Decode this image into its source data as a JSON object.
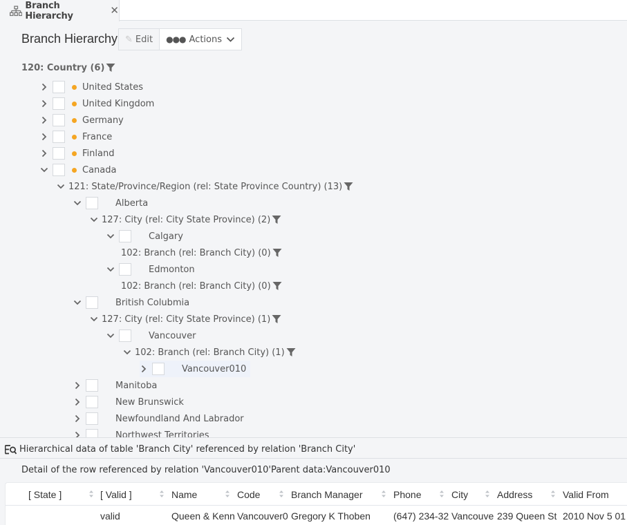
{
  "tab": {
    "icon": "hierarchy-icon",
    "label": "Branch Hierarchy",
    "close_icon": "close-icon"
  },
  "header": {
    "title": "Branch Hierarchy",
    "edit_label": "Edit",
    "actions_label": "Actions"
  },
  "tree": {
    "root_group": "120: Country (6)",
    "countries": [
      {
        "label": "United States",
        "expanded": false
      },
      {
        "label": "United Kingdom",
        "expanded": false
      },
      {
        "label": "Germany",
        "expanded": false
      },
      {
        "label": "France",
        "expanded": false
      },
      {
        "label": "Finland",
        "expanded": false
      },
      {
        "label": "Canada",
        "expanded": true
      }
    ],
    "canada": {
      "group": "121: State/Province/Region (rel: State Province Country) (13)",
      "alberta": {
        "label": "Alberta",
        "group": "127: City (rel: City State Province) (2)",
        "calgary": {
          "label": "Calgary",
          "group": "102: Branch (rel: Branch City) (0)"
        },
        "edmonton": {
          "label": "Edmonton",
          "group": "102: Branch (rel: Branch City) (0)"
        }
      },
      "bc": {
        "label": "British Colubmia",
        "group": "127: City (rel: City State Province) (1)",
        "vancouver": {
          "label": "Vancouver",
          "group": "102: Branch (rel: Branch City) (1)",
          "branch": "Vancouver010"
        }
      },
      "other_provinces": [
        "Manitoba",
        "New Brunswick",
        "Newfoundland And Labrador",
        "Northwest Territories"
      ]
    }
  },
  "bottom_panel": {
    "title": "Hierarchical data of table 'Branch City' referenced by relation 'Branch City'",
    "detail": "Detail of the row referenced by relation 'Vancouver010'Parent data:Vancouver010",
    "table": {
      "columns": [
        "[ State ]",
        "[ Valid ]",
        "Name",
        "Code",
        "Branch Manager",
        "Phone",
        "City",
        "Address",
        "Valid From"
      ],
      "rows": [
        [
          "",
          "valid",
          "Queen & Kenn",
          "Vancouver0",
          "Gregory K Thoben",
          "(647) 234-32",
          "Vancouve",
          "239 Queen St",
          "2010 Nov 5 01"
        ]
      ]
    }
  },
  "colors": {
    "status_dot": "#f5a623",
    "background": "#f4f5f7",
    "selected_row": "#eef2fa"
  }
}
